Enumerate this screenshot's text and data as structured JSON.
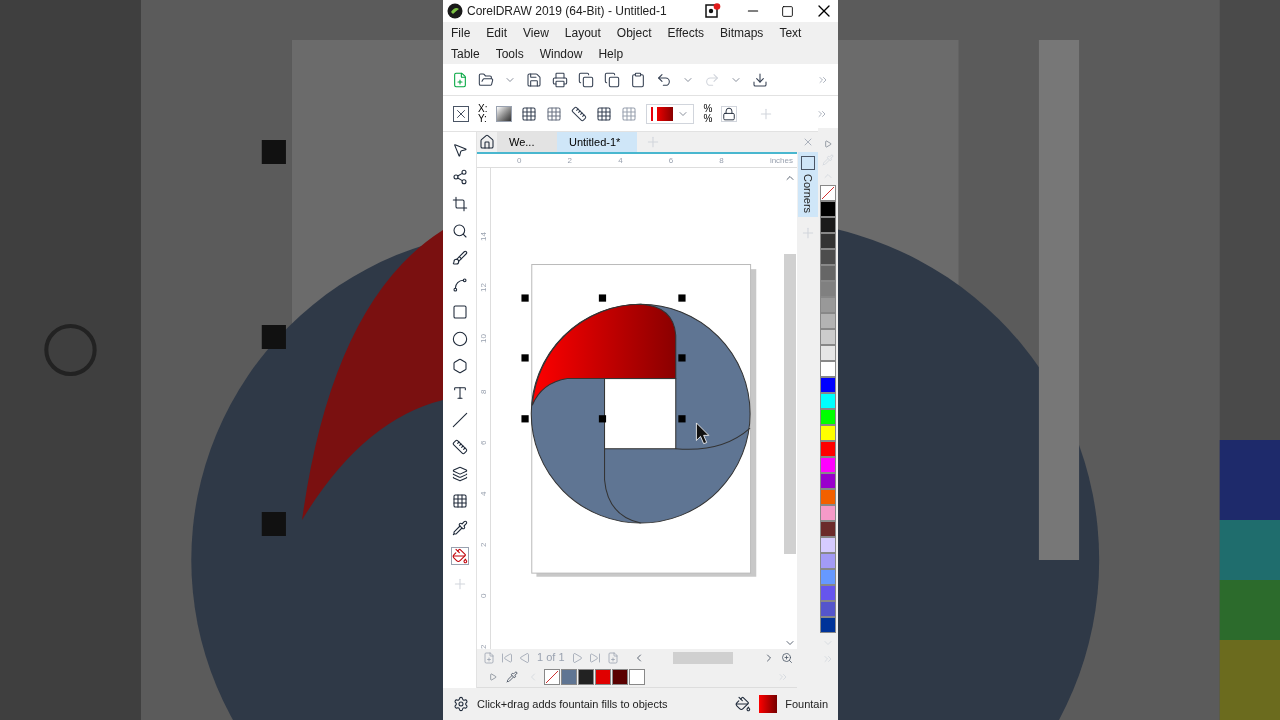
{
  "window": {
    "title": "CorelDRAW 2019 (64-Bit) - Untitled-1"
  },
  "menus": [
    "File",
    "Edit",
    "View",
    "Layout",
    "Object",
    "Effects",
    "Bitmaps",
    "Text",
    "Table",
    "Tools",
    "Window",
    "Help"
  ],
  "property_bar": {
    "x_label": "X:",
    "y_label": "Y:",
    "percent_labels": [
      "%",
      "%"
    ]
  },
  "tabs": [
    {
      "label": "We...",
      "selected": false
    },
    {
      "label": "Untitled-1*",
      "selected": true
    }
  ],
  "ruler": {
    "horizontal_labels": [
      "0",
      "2",
      "4",
      "6",
      "8"
    ],
    "unit": "inches",
    "vertical_labels": [
      "14",
      "12",
      "10",
      "8",
      "6",
      "4",
      "2",
      "0",
      "2"
    ]
  },
  "docker": {
    "tabs": [
      {
        "label": "Corners",
        "selected": true
      }
    ]
  },
  "page_nav": {
    "label": "1 of 1"
  },
  "color_palette": [
    {
      "kind": "none"
    },
    {
      "kind": "color",
      "color": "#000000"
    },
    {
      "kind": "color",
      "color": "#1a1a1a"
    },
    {
      "kind": "color",
      "color": "#333333"
    },
    {
      "kind": "color",
      "color": "#4d4d4d"
    },
    {
      "kind": "color",
      "color": "#666666"
    },
    {
      "kind": "color",
      "color": "#808080"
    },
    {
      "kind": "color",
      "color": "#999999"
    },
    {
      "kind": "color",
      "color": "#b3b3b3"
    },
    {
      "kind": "color",
      "color": "#cccccc"
    },
    {
      "kind": "color",
      "color": "#e6e6e6"
    },
    {
      "kind": "color",
      "color": "#ffffff"
    },
    {
      "kind": "color",
      "color": "#0000ff"
    },
    {
      "kind": "color",
      "color": "#00ffff"
    },
    {
      "kind": "color",
      "color": "#00ff00"
    },
    {
      "kind": "color",
      "color": "#ffff00"
    },
    {
      "kind": "color",
      "color": "#ff0000"
    },
    {
      "kind": "color",
      "color": "#ff00ff"
    },
    {
      "kind": "color",
      "color": "#9900cc"
    },
    {
      "kind": "color",
      "color": "#f26000"
    },
    {
      "kind": "color",
      "color": "#f59ac8"
    },
    {
      "kind": "color",
      "color": "#6b2a2a"
    },
    {
      "kind": "color",
      "color": "#d6ccff"
    },
    {
      "kind": "color",
      "color": "#a39bf5"
    },
    {
      "kind": "color",
      "color": "#6699ff"
    },
    {
      "kind": "color",
      "color": "#6655ee"
    },
    {
      "kind": "color",
      "color": "#5555cc"
    },
    {
      "kind": "color",
      "color": "#003399"
    }
  ],
  "document_palette": [
    {
      "kind": "none"
    },
    {
      "kind": "color",
      "color": "#5f7593"
    },
    {
      "kind": "color",
      "color": "#222222"
    },
    {
      "kind": "color",
      "color": "#e00000"
    },
    {
      "kind": "color",
      "color": "#5a0000"
    },
    {
      "kind": "color",
      "color": "#ffffff"
    }
  ],
  "status_bar": {
    "hint": "Click+drag adds fountain fills to objects",
    "fill_label": "Fountain"
  }
}
